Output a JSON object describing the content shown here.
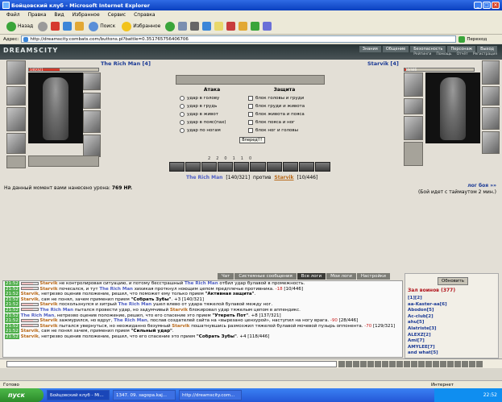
{
  "window": {
    "title": "Бойцовский клуб - Microsoft Internet Explorer"
  },
  "menu": [
    "Файл",
    "Правка",
    "Вид",
    "Избранное",
    "Сервис",
    "Справка"
  ],
  "toolbar": {
    "back": "Назад",
    "search": "Поиск",
    "favorites": "Избранное"
  },
  "address": {
    "label": "Адрес:",
    "url": "http://dreamscity.combats.com/buttons.pl?battle=0.351765756406706",
    "go": "Переход"
  },
  "game": {
    "logo": "DREAMSCITY",
    "topnav": [
      "Знания",
      "Общение",
      "Безопасность",
      "Персонаж",
      "Выход"
    ],
    "topnav2": [
      "Рейтинги",
      "Помощь",
      "Отчёт",
      "Регистрация"
    ],
    "player1": {
      "name": "The Rich Man [4]",
      "hp": "140/321"
    },
    "player2": {
      "name": "Starvik [4]",
      "hp": "10/446"
    },
    "attack": {
      "title": "Атака",
      "options": [
        "удар в голову",
        "удар в грудь",
        "удар в живот",
        "удар в пояс(пах)",
        "удар по ногам"
      ]
    },
    "defense": {
      "title": "Защита",
      "options": [
        "блок головы и груди",
        "блок груди и живота",
        "блок живота и пояса",
        "блок пояса и ног",
        "блок ног и головы"
      ]
    },
    "go_button": "Вперед!!!",
    "stats": [
      "2",
      "2",
      "0",
      "1",
      "1",
      "0"
    ],
    "versus": {
      "p1": "The Rich Man",
      "p1hp": "[140/321]",
      "word": "против",
      "p2": "Starvik",
      "p2hp": "[10/446]"
    },
    "damage": {
      "text": "На данный момент вами нанесено урона:",
      "value": "769 HP."
    },
    "log_link": "лог боя »»",
    "timeout": "(Бой идет с таймаутом 2 мин.)",
    "tabs": [
      "Чат",
      "Системные сообщения",
      "Все логи",
      "Мои логи",
      "Настройки"
    ],
    "chat": [
      {
        "time": "21:52",
        "a": "Starvik",
        "t1": " не контролировая ситуацию, и потому бесстрашный ",
        "b": "The Rich Man",
        "t2": " отбил удар булавой в промежность."
      },
      {
        "time": "21:52",
        "a": "Starvik",
        "t1": " почесался, и тут ",
        "b": "The Rich Man",
        "t2": " хихикая проткнул ноющим цепом предплечье противника. ",
        "r": "-18",
        "t3": " [10/446]"
      },
      {
        "time": "21:52",
        "a": "Starvik",
        "t1": ", нетрезво оценив положение, решил, что поможет ему только прием ",
        "b": "\"Активная защита\"",
        "t2": "."
      },
      {
        "time": "21:52",
        "a": "Starvik",
        "t1": ", сам не понял, зачем применил прием ",
        "b": "\"Собрать Зубы\"",
        "t2": ". +3 [140/321]"
      },
      {
        "time": "21:52",
        "a": "Starvik",
        "t1": " поскользнулся и хитрый ",
        "b": "The Rich Man",
        "t2": " ушел влево от удара тяжелой булавой между ног."
      },
      {
        "time": "21:52",
        "a": "The Rich Man",
        "t1": " пытался провести удар, но задумчивый ",
        "b": "Starvik",
        "t2": " блокировал удар тяжелым цепом в аппендикс."
      },
      {
        "time": "21:52",
        "a": "The Rich Man",
        "t1": ", нетрезво оценив положение, решил, что его спасение это прием ",
        "b": "\"Утереть Пот\"",
        "t2": ". +8 [137/321]"
      },
      {
        "time": "21:52",
        "a": "Starvik",
        "t1": " зажмурился, но вдруг, ",
        "b": "The Rich Man",
        "t2": ", послав создателей сайта на «вырезано цензурой», наступил на ногу врага. ",
        "r": "-90",
        "t3": " [28/446]"
      },
      {
        "time": "21:52",
        "a": "Starvik",
        "t1": " пытался увернуться, но неожиданно безумный ",
        "b": "Starvik",
        "t2": " пошатнувшись размозжил тяжелой булавой мочевой пузырь оппонента. ",
        "r": "-70",
        "t3": " [129/321]"
      },
      {
        "time": "21:52",
        "a": "Starvik",
        "t1": ", сам не понял зачем, применил прием ",
        "b": "\"Сильный удар\"",
        "t2": "."
      },
      {
        "time": "21:52",
        "a": "Starvik",
        "t1": ", нетрезво оценив положение, решил, что его спасение это прием ",
        "b": "\"Собрать Зубы\"",
        "t2": ". +4 [118/446]"
      }
    ],
    "side": {
      "refresh": "Обновить",
      "title": "Зал воинов (377)",
      "pages": "[1][2]",
      "users": [
        "aa-Kaster-aa[6]",
        "Abodon[5]",
        "Ac-club[2]",
        "ahu[5]",
        "Alatriste[3]",
        "ALEXZ[2]",
        "Ami[7]",
        "AMYLEE[7]",
        "and what[5]"
      ]
    }
  },
  "status": {
    "left": "Готово",
    "right": "Интернет"
  },
  "taskbar": {
    "start": "пуск",
    "tasks": [
      "Бойцовский клуб - Mi...",
      "1347. 09. заgора.kaj...",
      "http://dreamscity.com..."
    ],
    "time": "22:52"
  }
}
